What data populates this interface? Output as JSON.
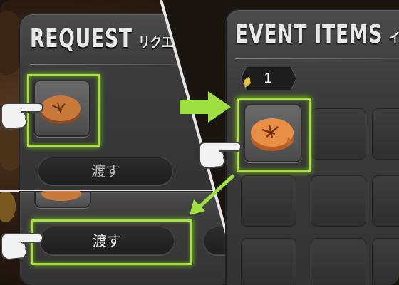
{
  "request_panel": {
    "title": "REQUEST",
    "title_jp": "リクエスト",
    "hand_over_label": "渡す"
  },
  "event_items_panel": {
    "title": "EVENT ITEMS",
    "title_jp": "イベントアイテム",
    "item_count": "1",
    "item_name_icon": "pie-icon"
  },
  "colors": {
    "highlight": "#a8e044",
    "arrow": "#9ee040",
    "panel": "#3b3b3b"
  },
  "icons": [
    "pointing-hand-icon",
    "pie-icon",
    "arrow-right-icon",
    "arrow-down-left-icon",
    "crystal-icon"
  ]
}
